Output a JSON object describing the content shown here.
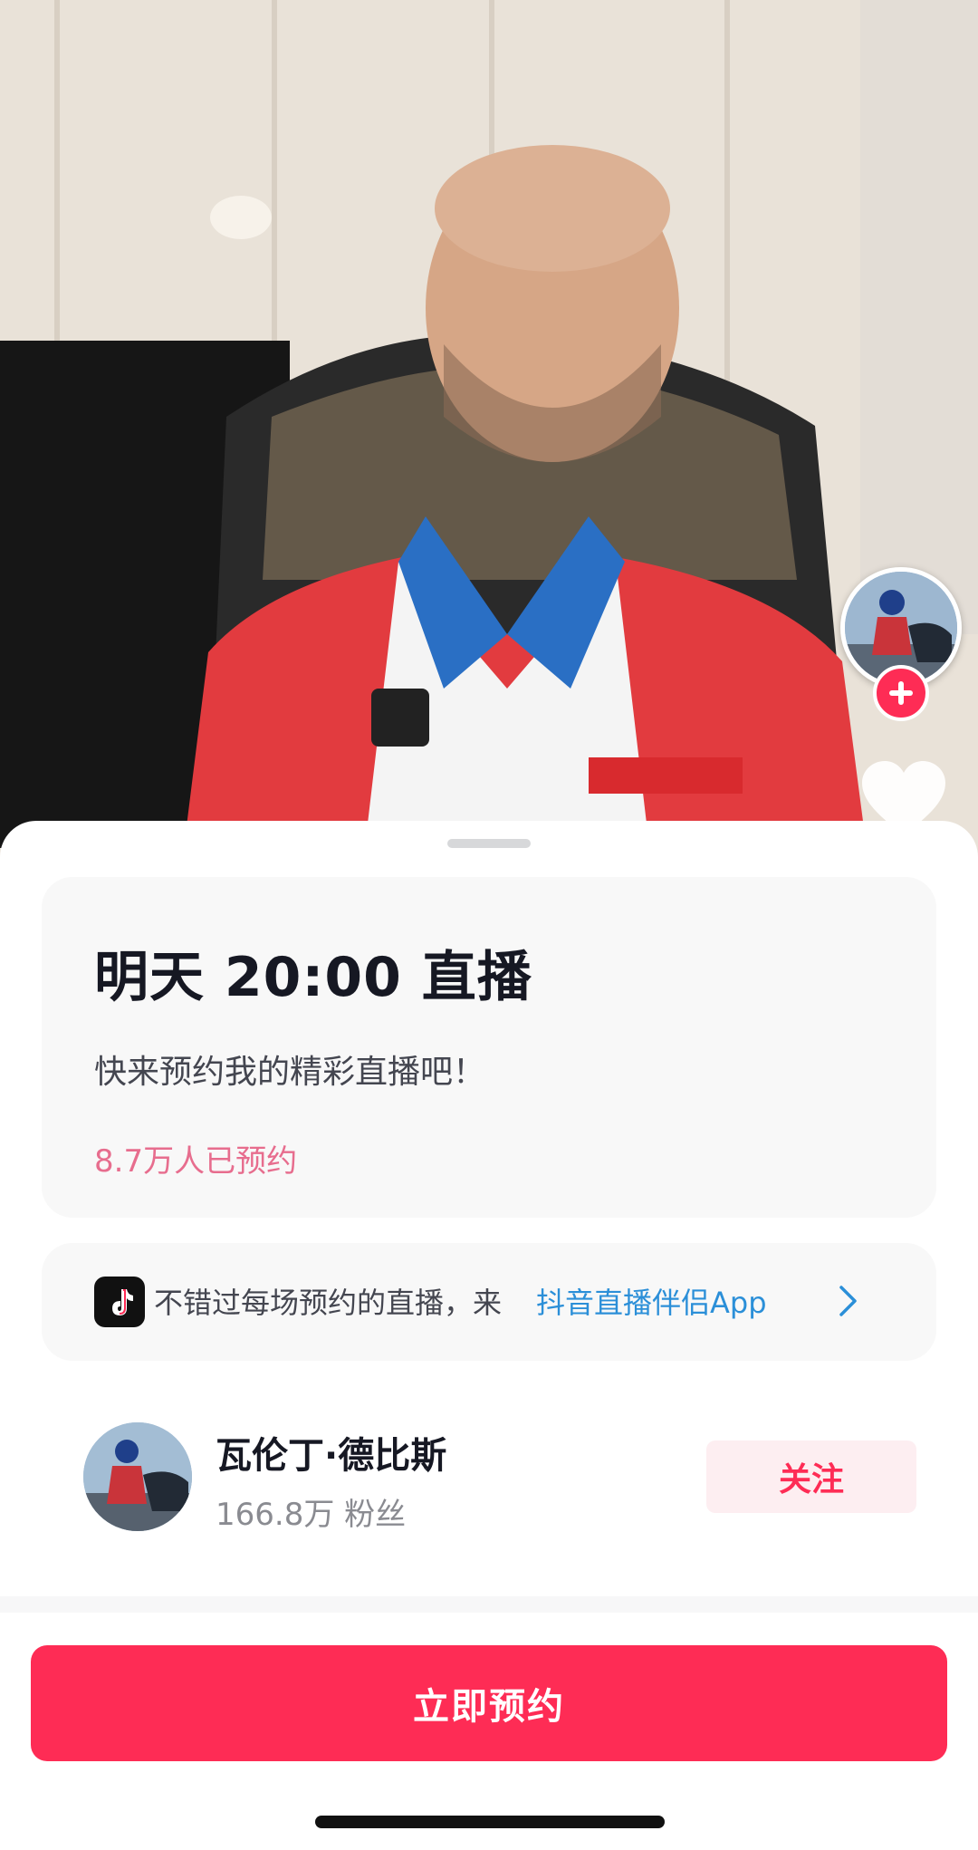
{
  "video": {
    "description_icon": "person-in-office-video-frame"
  },
  "side_actions": {
    "avatar_icon": "creator-avatar",
    "follow_icon": "plus-icon",
    "like_icon": "heart-icon"
  },
  "reservation": {
    "title": "明天 20:00 直播",
    "subtitle": "快来预约我的精彩直播吧！",
    "reserved_count": "8.7万人已预约"
  },
  "promo": {
    "text": "不错过每场预约的直播，来",
    "link": "抖音直播伴侣App",
    "logo_icon": "douyin-logo-icon",
    "chevron_icon": "chevron-right-icon"
  },
  "author": {
    "name": "瓦伦丁·德比斯",
    "fans": "166.8万 粉丝",
    "follow_label": "关注"
  },
  "cta": {
    "label": "立即预约"
  },
  "colors": {
    "brand_red": "#fe2c55",
    "count_pink": "#e76d8e",
    "link_blue": "#2b8fd8"
  }
}
